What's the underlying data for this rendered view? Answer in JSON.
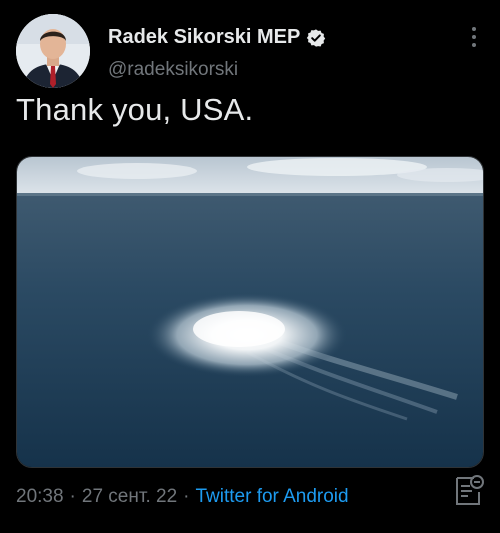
{
  "author": {
    "name": "Radek Sikorski MEP",
    "handle": "@radeksikorski",
    "verified": true
  },
  "tweet": {
    "text": "Thank you, USA."
  },
  "meta": {
    "time": "20:38",
    "date": "27 сент. 22",
    "source": "Twitter for Android"
  },
  "colors": {
    "background": "#000000",
    "text_primary": "#e7e9ea",
    "text_secondary": "#71767b",
    "link": "#1d9bf0"
  },
  "icons": {
    "verified": "verified-badge-icon",
    "more": "more-options-icon",
    "analytics": "view-analytics-icon"
  }
}
